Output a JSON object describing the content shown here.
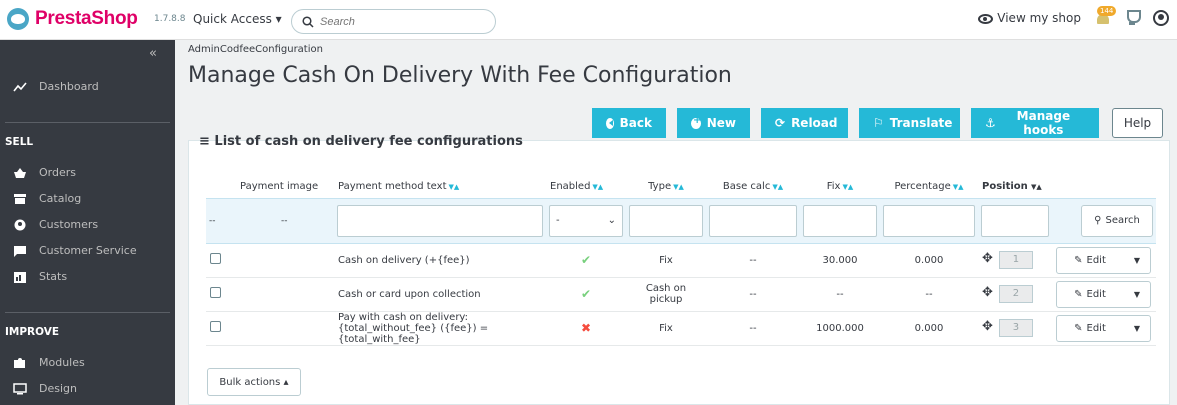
{
  "header": {
    "brand": "PrestaShop",
    "version": "1.7.8.8",
    "quick_access": "Quick Access",
    "search_placeholder": "Search",
    "view_shop": "View my shop",
    "notifications_count": "144"
  },
  "sidebar": {
    "dashboard": "Dashboard",
    "sell_heading": "SELL",
    "sell_items": [
      "Orders",
      "Catalog",
      "Customers",
      "Customer Service",
      "Stats"
    ],
    "improve_heading": "IMPROVE",
    "improve_items": [
      "Modules",
      "Design"
    ]
  },
  "breadcrumb": "AdminCodfeeConfiguration",
  "page_title": "Manage Cash On Delivery With Fee Configuration",
  "toolbar": {
    "back": "Back",
    "new": "New",
    "reload": "Reload",
    "translate": "Translate",
    "manage_hooks": "Manage hooks",
    "help": "Help"
  },
  "panel_title": "List of cash on delivery fee configurations",
  "table": {
    "headers": [
      "Payment image",
      "Payment method text",
      "Enabled",
      "Type",
      "Base calc",
      "Fix",
      "Percentage",
      "Position"
    ],
    "filter": {
      "image_placeholder": "--",
      "id_placeholder": "--",
      "enabled_value": "-",
      "search_label": "Search"
    },
    "rows": [
      {
        "text": "Cash on delivery (+{fee})",
        "enabled": true,
        "type": "Fix",
        "base": "--",
        "fix": "30.000",
        "percentage": "0.000",
        "position": "1",
        "edit": "Edit"
      },
      {
        "text": "Cash or card upon collection",
        "enabled": true,
        "type": "Cash on pickup",
        "base": "--",
        "fix": "--",
        "percentage": "--",
        "position": "2",
        "edit": "Edit"
      },
      {
        "text_line1": "Pay with cash on delivery:",
        "text_line2": "{total_without_fee} ({fee}) = {total_with_fee}",
        "enabled": false,
        "type": "Fix",
        "base": "--",
        "fix": "1000.000",
        "percentage": "0.000",
        "position": "3",
        "edit": "Edit"
      }
    ]
  },
  "bulk_actions": "Bulk actions"
}
